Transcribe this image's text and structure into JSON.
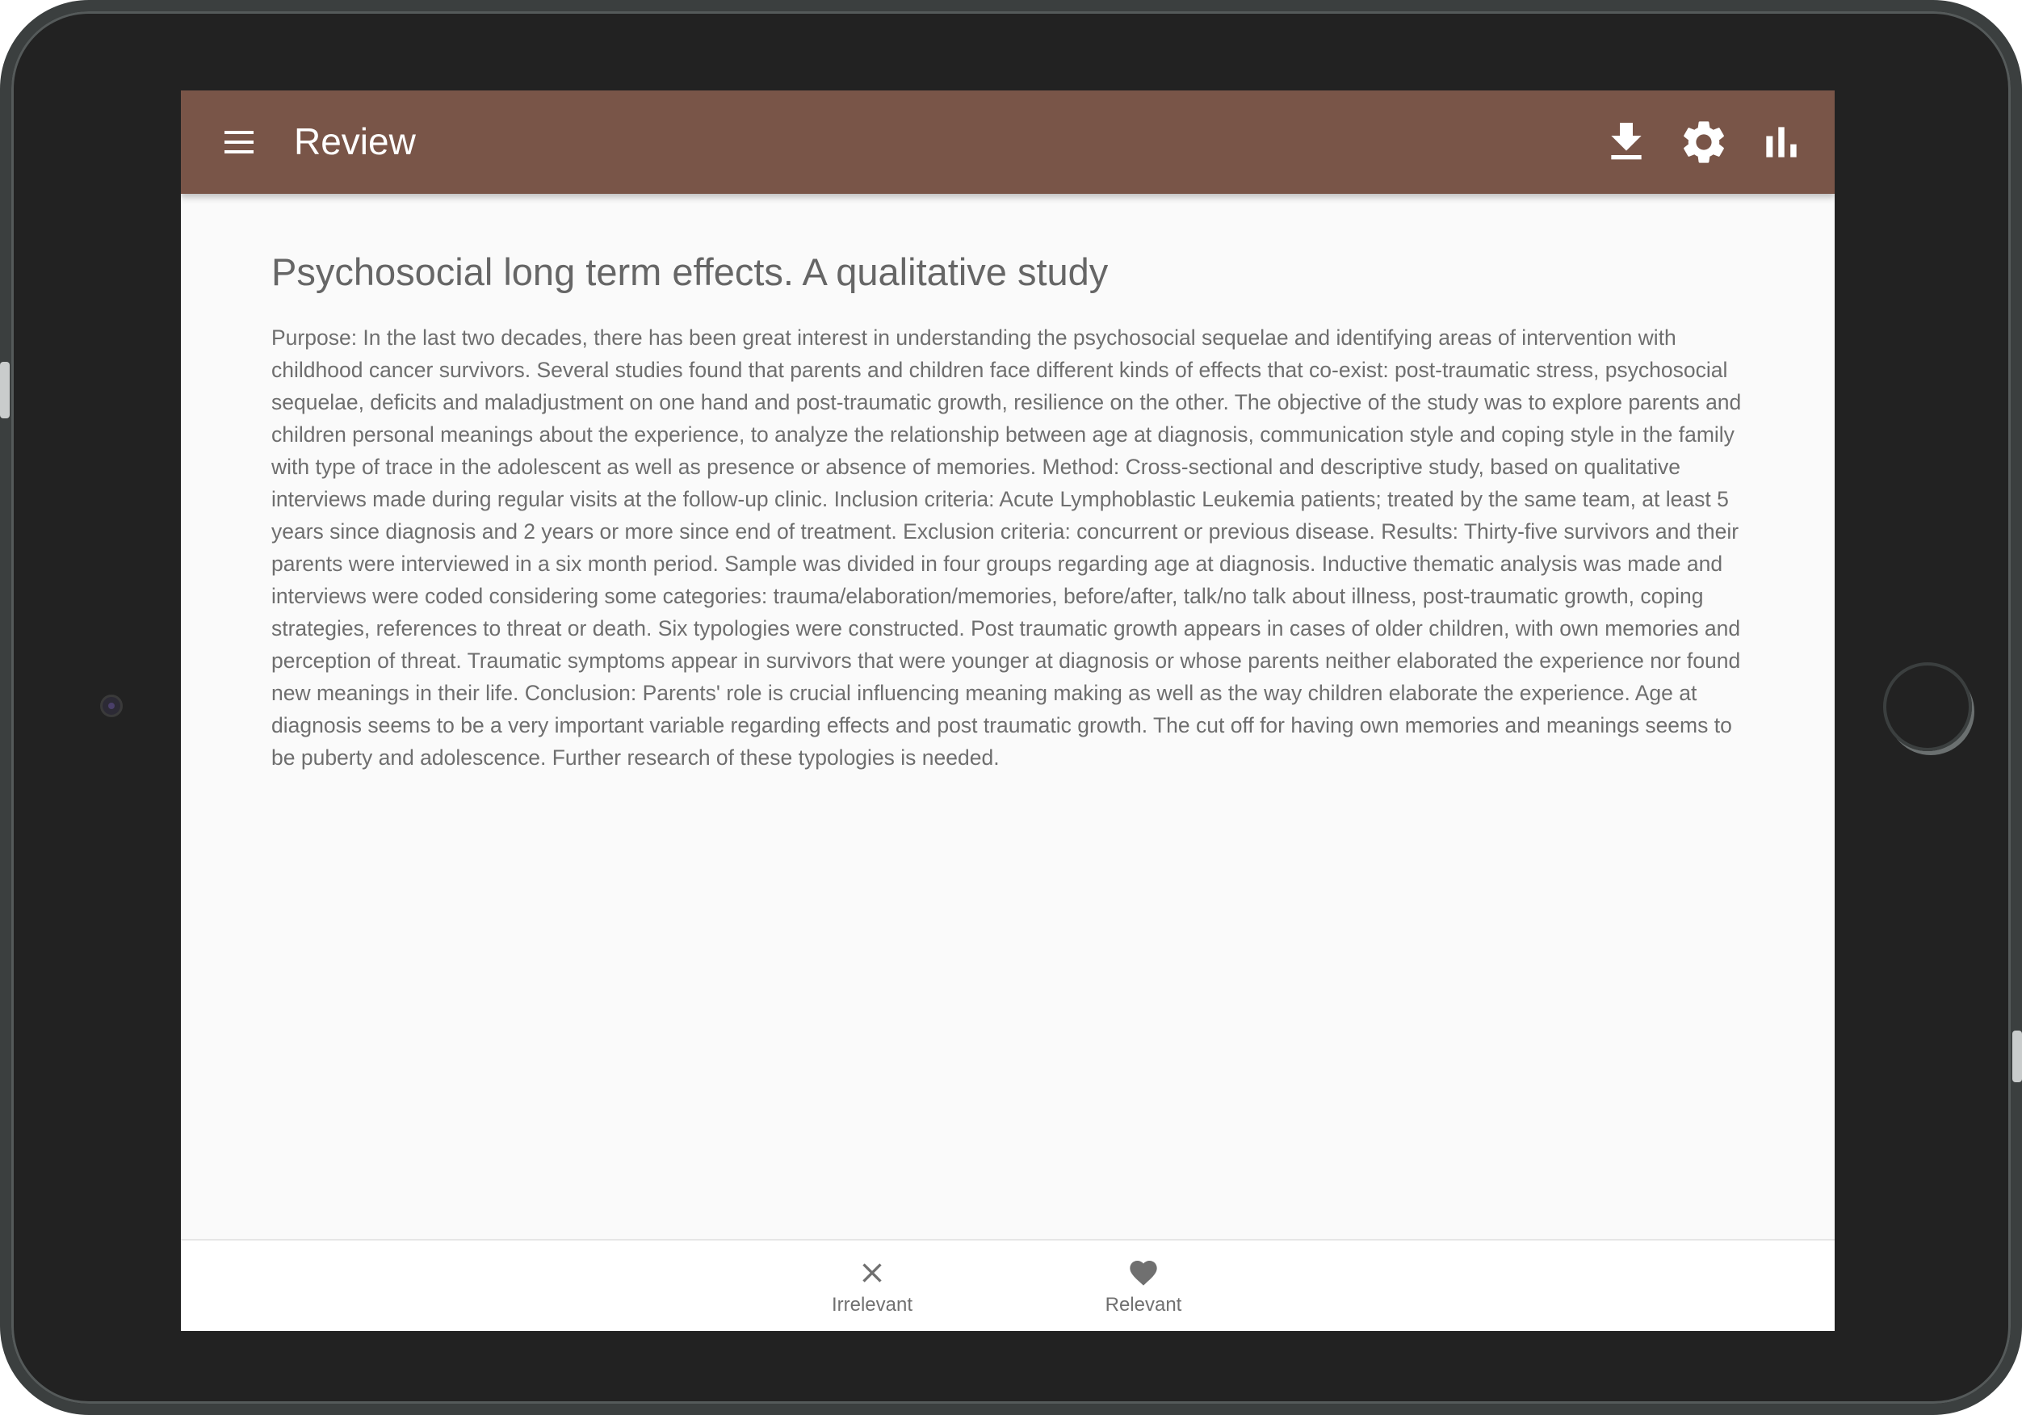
{
  "app_bar": {
    "title": "Review",
    "menu_icon": "menu-icon",
    "actions": [
      {
        "icon": "download-icon"
      },
      {
        "icon": "settings-icon"
      },
      {
        "icon": "bar-chart-icon"
      }
    ],
    "color": "#795548"
  },
  "document": {
    "title": "Psychosocial long term effects. A qualitative study",
    "abstract": "Purpose: In the last two decades, there has been great interest in understanding the psychosocial sequelae and identifying areas of intervention with childhood cancer survivors. Several studies found that parents and children face different kinds of effects that co-exist: post-traumatic stress, psychosocial sequelae, deficits and maladjustment on one hand and post-traumatic growth, resilience on the other. The objective of the study was to explore parents and children personal meanings about the experience, to analyze the relationship between age at diagnosis, communication style and coping style in the family with type of trace in the adolescent as well as presence or absence of memories. Method: Cross-sectional and descriptive study, based on qualitative interviews made during regular visits at the follow-up clinic. Inclusion criteria: Acute Lymphoblastic Leukemia patients; treated by the same team, at least 5 years since diagnosis and 2 years or more since end of treatment. Exclusion criteria: concurrent or previous disease. Results: Thirty-five survivors and their parents were interviewed in a six month period. Sample was divided in four groups regarding age at diagnosis. Inductive thematic analysis was made and interviews were coded considering some categories: trauma/elaboration/memories, before/after, talk/no talk about illness, post-traumatic growth, coping strategies, references to threat or death. Six typologies were constructed. Post traumatic growth appears in cases of older children, with own memories and perception of threat. Traumatic symptoms appear in survivors that were younger at diagnosis or whose parents neither elaborated the experience nor found new meanings in their life. Conclusion: Parents' role is crucial influencing meaning making as well as the way children elaborate the experience. Age at diagnosis seems to be a very important variable regarding effects and post traumatic growth. The cut off for having own memories and meanings seems to be puberty and adolescence. Further research of these typologies is needed."
  },
  "bottom_bar": {
    "irrelevant": {
      "label": "Irrelevant",
      "icon": "close-icon"
    },
    "relevant": {
      "label": "Relevant",
      "icon": "heart-icon"
    }
  }
}
